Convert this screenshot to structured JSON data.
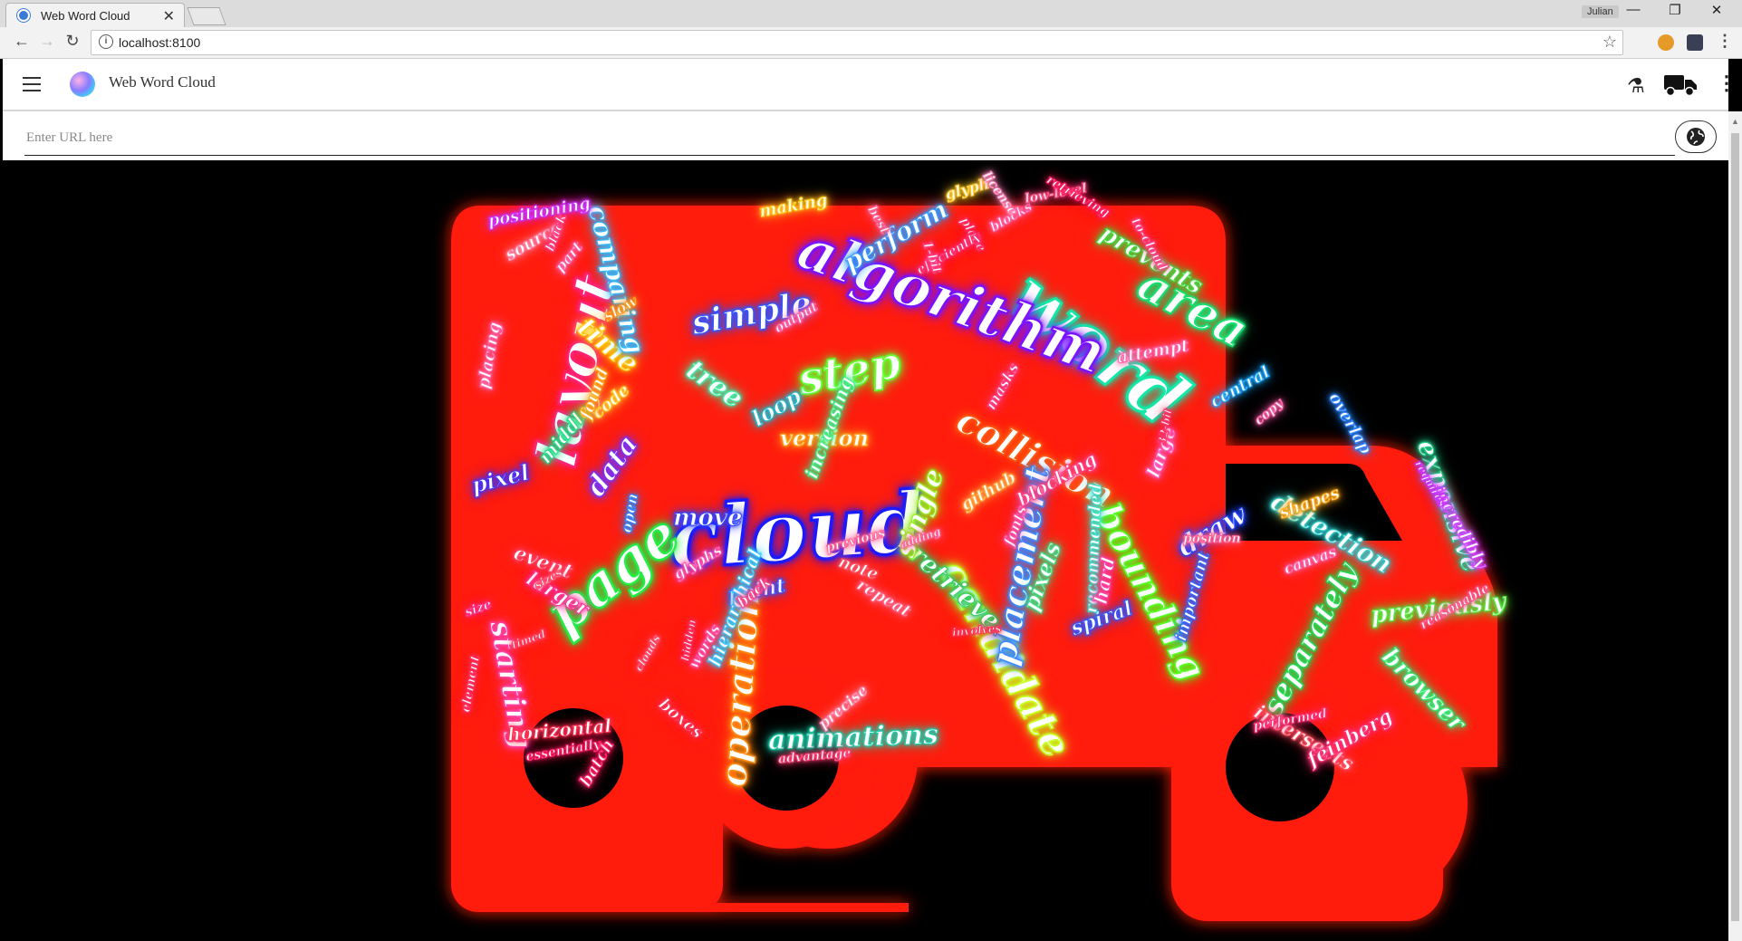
{
  "browser": {
    "tab_title": "Web Word Cloud",
    "tab_close": "✕",
    "user": "Julian",
    "url": "localhost:8100",
    "window_controls": [
      "—",
      "❐",
      "✕"
    ]
  },
  "app": {
    "title": "Web Word Cloud",
    "url_input_placeholder": "Enter URL here",
    "icons": [
      "menu-icon",
      "logo-icon",
      "flask-icon",
      "truck-icon",
      "more-vert-icon",
      "globe-icon"
    ]
  },
  "cloud": {
    "mask_shape": "truck",
    "words": [
      {
        "text": "cloud",
        "color": "#1a1aff"
      },
      {
        "text": "word",
        "color": "#12e8a8"
      },
      {
        "text": "algorithm",
        "color": "#7a12ff"
      },
      {
        "text": "page",
        "color": "#22ee44"
      },
      {
        "text": "layout",
        "color": "#ff2277"
      },
      {
        "text": "area",
        "color": "#16e070"
      },
      {
        "text": "collision",
        "color": "#ff5a12"
      },
      {
        "text": "candidate",
        "color": "#c8ff22"
      },
      {
        "text": "placement",
        "color": "#3a8bff"
      },
      {
        "text": "bounding",
        "color": "#55ff22"
      },
      {
        "text": "operation",
        "color": "#ff8a12"
      },
      {
        "text": "step",
        "color": "#66ff33"
      },
      {
        "text": "simple",
        "color": "#3355ff"
      },
      {
        "text": "retrieve",
        "color": "#33cc66"
      },
      {
        "text": "separately",
        "color": "#22dd55"
      },
      {
        "text": "previously",
        "color": "#55ee44"
      },
      {
        "text": "expensive",
        "color": "#22cc88"
      },
      {
        "text": "time",
        "color": "#ffcc11"
      },
      {
        "text": "data",
        "color": "#7733ff"
      },
      {
        "text": "tree",
        "color": "#44eeaa"
      },
      {
        "text": "draw",
        "color": "#2244ff"
      },
      {
        "text": "detection",
        "color": "#33cccc"
      },
      {
        "text": "single",
        "color": "#99ee22"
      },
      {
        "text": "pixels",
        "color": "#44dd88"
      },
      {
        "text": "browser",
        "color": "#33ee77"
      },
      {
        "text": "starting",
        "color": "#ff44aa"
      },
      {
        "text": "animations",
        "color": "#22ccaa"
      },
      {
        "text": "comparing",
        "color": "#33bbff"
      },
      {
        "text": "perform",
        "color": "#3399ff"
      },
      {
        "text": "prevents",
        "color": "#44dd44"
      },
      {
        "text": "move",
        "color": "#3344ff"
      },
      {
        "text": "version",
        "color": "#ffaa22"
      },
      {
        "text": "pixel",
        "color": "#4433ff"
      },
      {
        "text": "loop",
        "color": "#22bbcc"
      },
      {
        "text": "larger",
        "color": "#ff3399"
      },
      {
        "text": "event",
        "color": "#ff4466"
      },
      {
        "text": "point",
        "color": "#3355ff"
      },
      {
        "text": "spiral",
        "color": "#3355ff"
      },
      {
        "text": "intersects",
        "color": "#ff5566"
      },
      {
        "text": "feinberg",
        "color": "#ff3377"
      },
      {
        "text": "positioning",
        "color": "#cc33ff"
      },
      {
        "text": "horizontal",
        "color": "#ff3355"
      },
      {
        "text": "making",
        "color": "#ffcc22"
      },
      {
        "text": "central",
        "color": "#22aaff"
      },
      {
        "text": "attempt",
        "color": "#ff66aa"
      },
      {
        "text": "github",
        "color": "#ffaa44"
      },
      {
        "text": "recommended",
        "color": "#44ddcc"
      },
      {
        "text": "hierarchical",
        "color": "#33ccff"
      },
      {
        "text": "important",
        "color": "#3366ff"
      },
      {
        "text": "hard",
        "color": "#ff44aa"
      },
      {
        "text": "blocking",
        "color": "#ff4488"
      },
      {
        "text": "large",
        "color": "#ff66cc"
      },
      {
        "text": "middle",
        "color": "#22dd88"
      },
      {
        "text": "code",
        "color": "#ffcc33"
      },
      {
        "text": "found",
        "color": "#ffaa22"
      },
      {
        "text": "source",
        "color": "#ff88aa"
      },
      {
        "text": "placing",
        "color": "#ff66aa"
      },
      {
        "text": "glyph",
        "color": "#ffcc33"
      },
      {
        "text": "repeat",
        "color": "#ff6688"
      },
      {
        "text": "note",
        "color": "#ff5566"
      },
      {
        "text": "back",
        "color": "#ff4488"
      },
      {
        "text": "boxes",
        "color": "#ff3355"
      },
      {
        "text": "batch",
        "color": "#ff2266"
      },
      {
        "text": "increasing",
        "color": "#44ee88"
      },
      {
        "text": "masks",
        "color": "#ff4488"
      },
      {
        "text": "shapes",
        "color": "#ffaa22"
      },
      {
        "text": "incredibly",
        "color": "#cc44ff"
      },
      {
        "text": "overlap",
        "color": "#3388ff"
      },
      {
        "text": "canvas",
        "color": "#ff66aa"
      },
      {
        "text": "reasonable",
        "color": "#ff5588"
      },
      {
        "text": "fonts",
        "color": "#ff55aa"
      },
      {
        "text": "performed",
        "color": "#ff3377"
      },
      {
        "text": "essentially",
        "color": "#ff2266"
      },
      {
        "text": "advantage",
        "color": "#ff4477"
      },
      {
        "text": "element",
        "color": "#ff3366"
      },
      {
        "text": "size",
        "color": "#ff3388"
      },
      {
        "text": "words",
        "color": "#ff55aa"
      },
      {
        "text": "precise",
        "color": "#ff88aa"
      },
      {
        "text": "position",
        "color": "#ff6699"
      },
      {
        "text": "glyphs",
        "color": "#ff55aa"
      },
      {
        "text": "open",
        "color": "#3388ff"
      },
      {
        "text": "slow",
        "color": "#ff9922"
      },
      {
        "text": "part",
        "color": "#ff66aa"
      },
      {
        "text": "black",
        "color": "#ff4488"
      },
      {
        "text": "output",
        "color": "#ff66aa"
      },
      {
        "text": "place",
        "color": "#ff3366"
      },
      {
        "text": "blocks",
        "color": "#ff66aa"
      },
      {
        "text": "best",
        "color": "#ff6699"
      },
      {
        "text": "license",
        "color": "#ff88bb"
      },
      {
        "text": "efficiently",
        "color": "#ff3377"
      },
      {
        "text": "low-level",
        "color": "#ff5588"
      },
      {
        "text": "retrieving",
        "color": "#ff2266"
      },
      {
        "text": "to-cloud",
        "color": "#ff4488"
      },
      {
        "text": "32-bit",
        "color": "#ff3366"
      },
      {
        "text": "1-bit",
        "color": "#ff4488"
      },
      {
        "text": "copy",
        "color": "#ff66aa"
      },
      {
        "text": "requires",
        "color": "#cc33ff"
      },
      {
        "text": "involves",
        "color": "#ff3355"
      },
      {
        "text": "previous",
        "color": "#ff6699"
      },
      {
        "text": "hidden",
        "color": "#ff3366"
      },
      {
        "text": "clouds",
        "color": "#ff5577"
      },
      {
        "text": "sizes",
        "color": "#ff5577"
      },
      {
        "text": "timed",
        "color": "#ff4466"
      },
      {
        "text": "adding",
        "color": "#ff6699"
      }
    ]
  }
}
